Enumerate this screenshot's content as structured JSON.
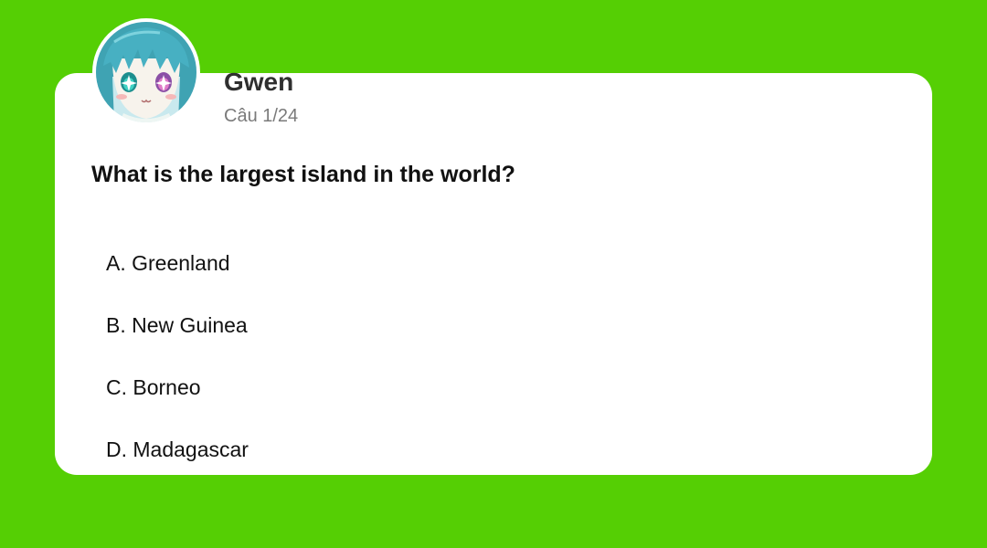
{
  "header": {
    "user_name": "Gwen",
    "question_counter": "Câu 1/24"
  },
  "quiz": {
    "question": "What is the largest island in the world?",
    "options": [
      "A. Greenland",
      "B. New Guinea",
      "C. Borneo",
      "D. Madagascar"
    ]
  },
  "colors": {
    "background": "#55cf04",
    "card": "#ffffff",
    "hair": "#3fa3b3",
    "eye": "#22b7a8"
  },
  "icons": {
    "avatar": "anime-girl-avatar"
  }
}
